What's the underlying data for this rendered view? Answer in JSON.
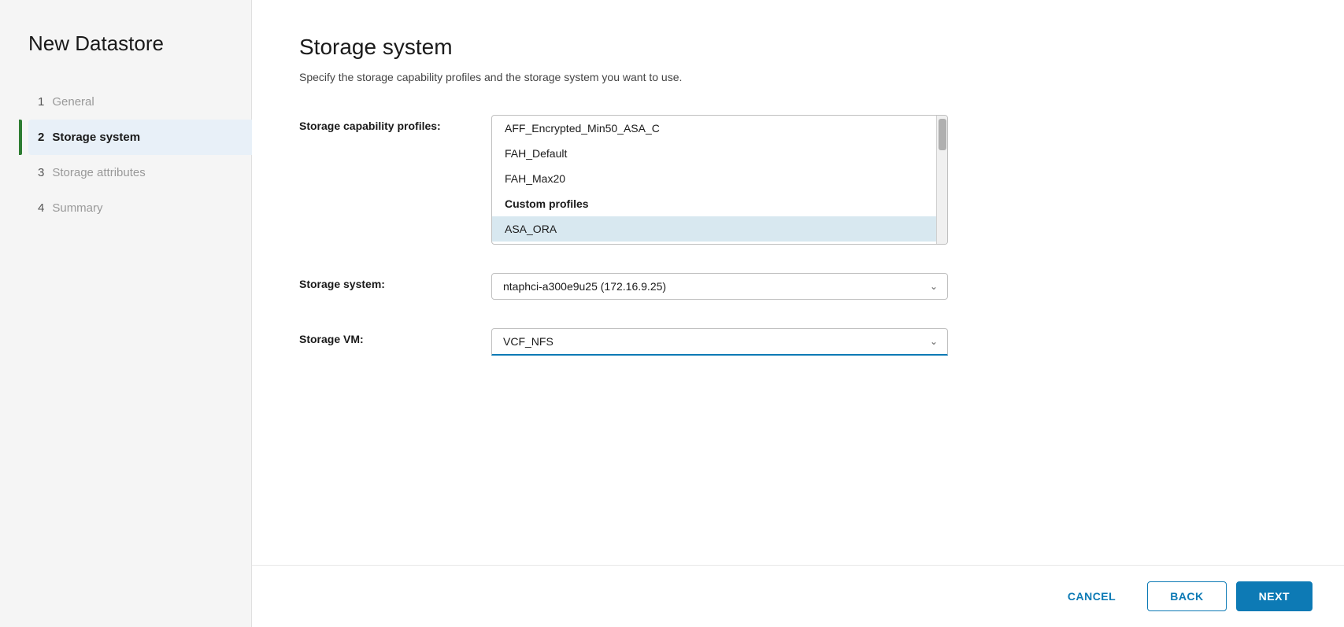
{
  "sidebar": {
    "title": "New Datastore",
    "steps": [
      {
        "num": "1",
        "label": "General",
        "state": "completed"
      },
      {
        "num": "2",
        "label": "Storage system",
        "state": "active"
      },
      {
        "num": "3",
        "label": "Storage attributes",
        "state": "inactive"
      },
      {
        "num": "4",
        "label": "Summary",
        "state": "inactive"
      }
    ]
  },
  "main": {
    "title": "Storage system",
    "description": "Specify the storage capability profiles and the storage system you want to use.",
    "fields": {
      "capability_profiles_label": "Storage capability profiles:",
      "storage_system_label": "Storage system:",
      "storage_vm_label": "Storage VM:"
    },
    "listbox_items": [
      {
        "label": "AFF_Encrypted_Min50_ASA_C",
        "type": "item",
        "selected": false
      },
      {
        "label": "FAH_Default",
        "type": "item",
        "selected": false
      },
      {
        "label": "FAH_Max20",
        "type": "item",
        "selected": false
      },
      {
        "label": "Custom profiles",
        "type": "group-header",
        "selected": false
      },
      {
        "label": "ASA_ORA",
        "type": "item",
        "selected": true
      }
    ],
    "storage_system_value": "ntaphci-a300e9u25 (172.16.9.25)",
    "storage_vm_value": "VCF_NFS"
  },
  "footer": {
    "cancel_label": "CANCEL",
    "back_label": "BACK",
    "next_label": "NEXT"
  }
}
